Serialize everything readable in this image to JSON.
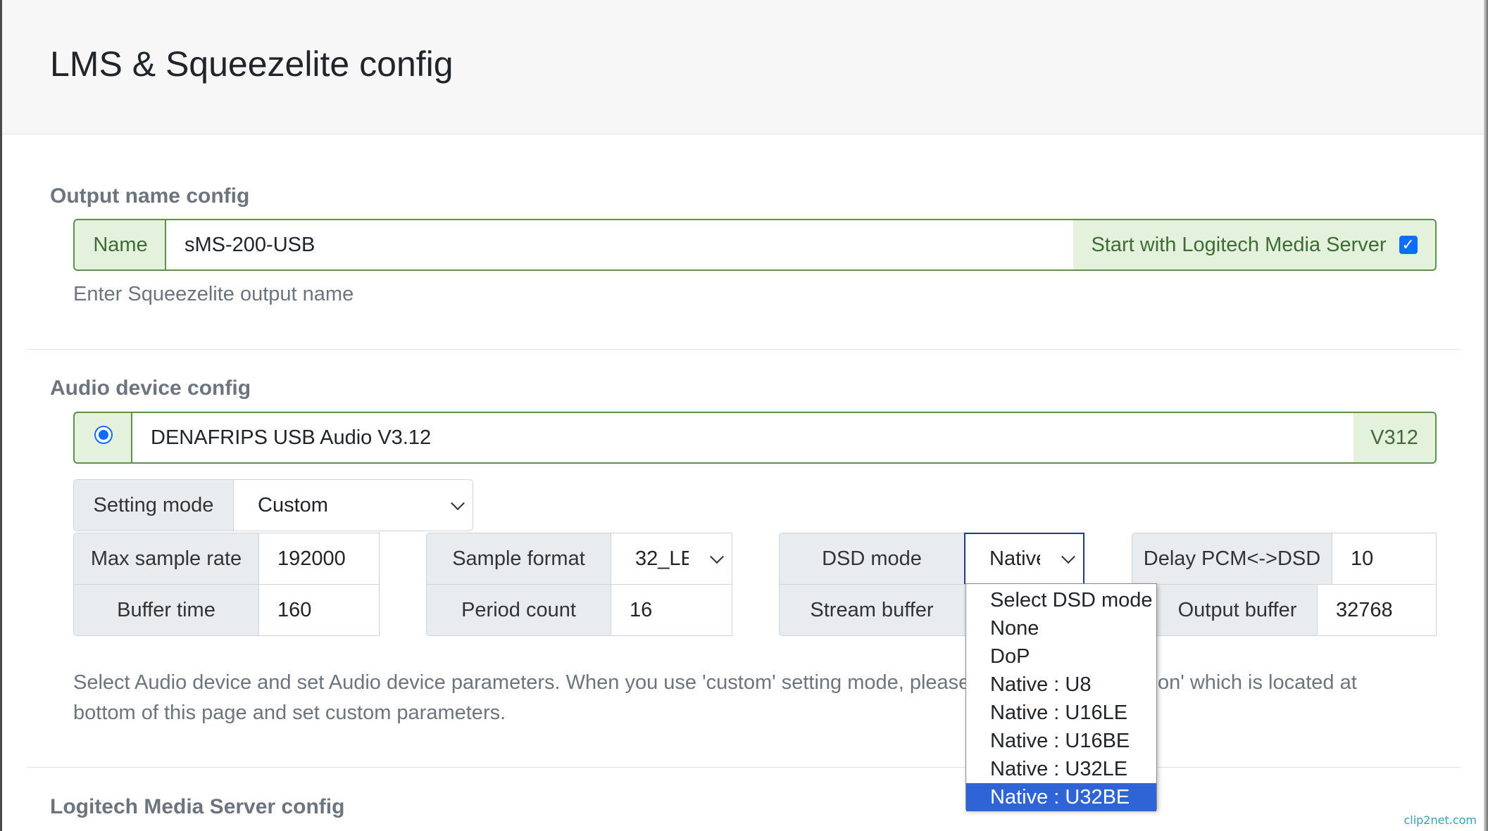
{
  "header": {
    "title": "LMS & Squeezelite config"
  },
  "output_name": {
    "section_title": "Output name config",
    "name_label": "Name",
    "name_value": "sMS-200-USB",
    "start_label": "Start with Logitech Media Server",
    "start_checked": true,
    "help": "Enter Squeezelite output name"
  },
  "audio_device": {
    "section_title": "Audio device config",
    "device_name": "DENAFRIPS USB Audio V3.12",
    "device_tag": "V312",
    "device_selected": true,
    "setting_mode_label": "Setting mode",
    "setting_mode_value": "Custom",
    "max_sample_rate_label": "Max sample rate",
    "max_sample_rate_value": "192000",
    "sample_format_label": "Sample format",
    "sample_format_value": "32_LE",
    "dsd_mode_label": "DSD mode",
    "dsd_mode_value": "Native : U32BE",
    "delay_label": "Delay PCM<->DSD",
    "delay_value": "10",
    "buffer_time_label": "Buffer time",
    "buffer_time_value": "160",
    "period_count_label": "Period count",
    "period_count_value": "16",
    "stream_buffer_label": "Stream buffer",
    "output_buffer_label": "Output buffer",
    "output_buffer_value": "32768",
    "help_line1_left": "Select Audio device and set Audio device parameters. When you use 'custom' setting mode, please r",
    "help_line1_right": "on' which is located at",
    "help_line2": "bottom of this page and set custom parameters."
  },
  "dsd_dropdown": {
    "options": [
      "Select DSD mode",
      "None",
      "DoP",
      "Native : U8",
      "Native : U16LE",
      "Native : U16BE",
      "Native : U32LE",
      "Native : U32BE"
    ],
    "selected_index": 7
  },
  "lms": {
    "section_title": "Logitech Media Server config"
  },
  "watermark": "clip2net.com",
  "colors": {
    "accent": "#0d6efd",
    "success_border": "#5e8f4d",
    "success_bg": "#e4f1dc",
    "selected_option": "#2f64d6"
  }
}
